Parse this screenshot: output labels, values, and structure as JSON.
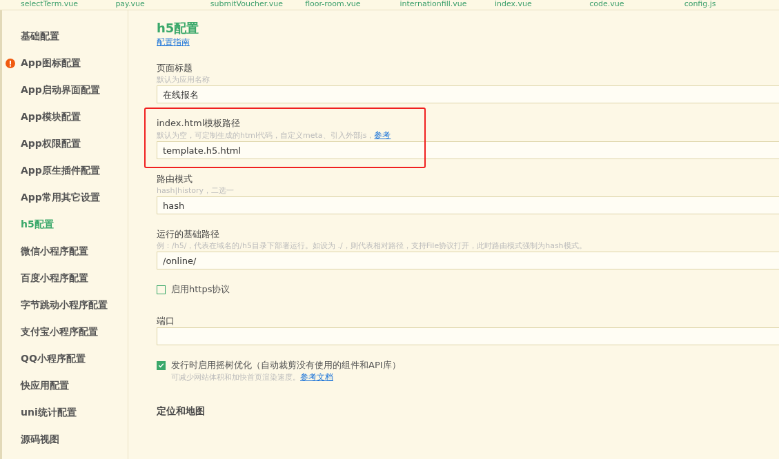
{
  "tabs": [
    {
      "label": "selectTerm.vue"
    },
    {
      "label": "pay.vue"
    },
    {
      "label": "submitVoucher.vue"
    },
    {
      "label": "floor-room.vue"
    },
    {
      "label": "internationfill.vue"
    },
    {
      "label": "index.vue"
    },
    {
      "label": "code.vue"
    },
    {
      "label": "config.js"
    }
  ],
  "sidebar": {
    "items": [
      {
        "label": "基础配置",
        "selected": false,
        "warning": false
      },
      {
        "label": "App图标配置",
        "selected": false,
        "warning": true
      },
      {
        "label": "App启动界面配置",
        "selected": false,
        "warning": false
      },
      {
        "label": "App模块配置",
        "selected": false,
        "warning": false
      },
      {
        "label": "App权限配置",
        "selected": false,
        "warning": false
      },
      {
        "label": "App原生插件配置",
        "selected": false,
        "warning": false
      },
      {
        "label": "App常用其它设置",
        "selected": false,
        "warning": false
      },
      {
        "label": "h5配置",
        "selected": true,
        "warning": false
      },
      {
        "label": "微信小程序配置",
        "selected": false,
        "warning": false
      },
      {
        "label": "百度小程序配置",
        "selected": false,
        "warning": false
      },
      {
        "label": "字节跳动小程序配置",
        "selected": false,
        "warning": false
      },
      {
        "label": "支付宝小程序配置",
        "selected": false,
        "warning": false
      },
      {
        "label": "QQ小程序配置",
        "selected": false,
        "warning": false
      },
      {
        "label": "快应用配置",
        "selected": false,
        "warning": false
      },
      {
        "label": "uni统计配置",
        "selected": false,
        "warning": false
      },
      {
        "label": "源码视图",
        "selected": false,
        "warning": false
      }
    ]
  },
  "content": {
    "title": "h5配置",
    "guide_link": "配置指南",
    "settings": [
      {
        "kind": "field",
        "label": "页面标题",
        "hint": "默认为应用名称",
        "value": "在线报名",
        "highlighted": false
      },
      {
        "kind": "field",
        "label": "index.html模板路径",
        "hint": "默认为空，可定制生成的html代码，自定义meta、引入外部js，",
        "hint_link": "参考",
        "value": "template.h5.html",
        "highlighted": true
      },
      {
        "kind": "field",
        "label": "路由模式",
        "hint": "hash|history，二选一",
        "value": "hash",
        "highlighted": false
      },
      {
        "kind": "field",
        "label": "运行的基础路径",
        "hint": "例：/h5/，代表在域名的/h5目录下部署运行。如设为 ./，则代表相对路径，支持File协议打开，此时路由模式强制为hash模式。",
        "value": "/online/",
        "highlighted": false
      },
      {
        "kind": "checkbox",
        "label": "启用https协议",
        "checked": false
      },
      {
        "kind": "field",
        "label": "端口",
        "highlighted": false
      },
      {
        "kind": "checkbox",
        "label": "发行时启用摇树优化（自动裁剪没有使用的组件和API库）",
        "checked": true,
        "hint": "可减少网站体积和加快首页渲染速度。",
        "hint_link": "参考文档"
      }
    ],
    "section_heading": "定位和地图"
  }
}
